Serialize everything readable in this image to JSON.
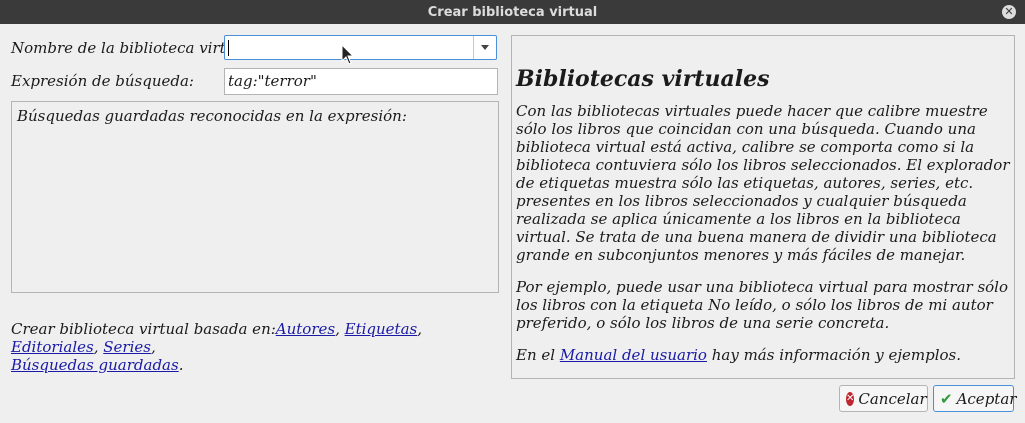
{
  "window": {
    "title": "Crear biblioteca virtual"
  },
  "form": {
    "name_label": "Nombre de la biblioteca virtual:",
    "name_value": "",
    "search_label": "Expresión de búsqueda:",
    "search_value": "tag:\"terror\"",
    "saved_searches_text": "Búsquedas guardadas reconocidas en la expresión:"
  },
  "create_based": {
    "prefix": "Crear biblioteca virtual basada en:",
    "links": [
      "Autores",
      "Etiquetas",
      "Editoriales",
      "Series",
      "Búsquedas guardadas"
    ],
    "suffix": "."
  },
  "help": {
    "heading": "Bibliotecas virtuales",
    "p1": "Con las bibliotecas virtuales puede hacer que calibre muestre sólo los libros que coincidan con una búsqueda. Cuando una biblioteca virtual está activa, calibre se comporta como si la biblioteca contuviera sólo los libros seleccionados. El explorador de etiquetas muestra sólo las etiquetas, autores, series, etc. presentes en los libros seleccionados y cualquier búsqueda realizada se aplica únicamente a los libros en la biblioteca virtual. Se trata de una buena manera de dividir una biblioteca grande en subconjuntos menores y más fáciles de manejar.",
    "p2": "Por ejemplo, puede usar una biblioteca virtual para mostrar sólo los libros con la etiqueta No leído, o sólo los libros de mi autor preferido, o sólo los libros de una serie concreta.",
    "p3_prefix": "En el ",
    "p3_link": "Manual del usuario",
    "p3_suffix": " hay más información y ejemplos."
  },
  "buttons": {
    "cancel": "Cancelar",
    "accept": "Aceptar"
  },
  "colors": {
    "titlebar": "#3a3a3a",
    "link": "#1a1aa6",
    "focus": "#4a90d9"
  }
}
